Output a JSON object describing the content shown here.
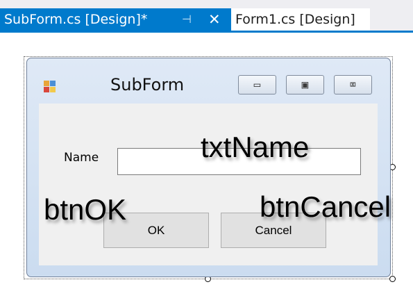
{
  "tabs": {
    "active": {
      "label": "SubForm.cs [Design]*",
      "pin_icon": "pin-icon",
      "close_icon": "close-icon",
      "pin_glyph": "⊣",
      "close_glyph": "✕"
    },
    "inactive": {
      "label": "Form1.cs [Design]"
    }
  },
  "form": {
    "title": "SubForm",
    "app_icon": "form-app-icon",
    "caption_buttons": {
      "minimize": "▭",
      "maximize": "▣",
      "close": "⌧"
    },
    "name_label": "Name",
    "name_value": "",
    "ok_label": "OK",
    "cancel_label": "Cancel"
  },
  "annotations": {
    "textbox": "txtName",
    "ok_button": "btnOK",
    "cancel_button": "btnCancel"
  },
  "colors": {
    "accent": "#007acc",
    "tab_bar": "#eeeef2",
    "client_area": "#f0f0f0",
    "button_face": "#e1e1e1"
  }
}
